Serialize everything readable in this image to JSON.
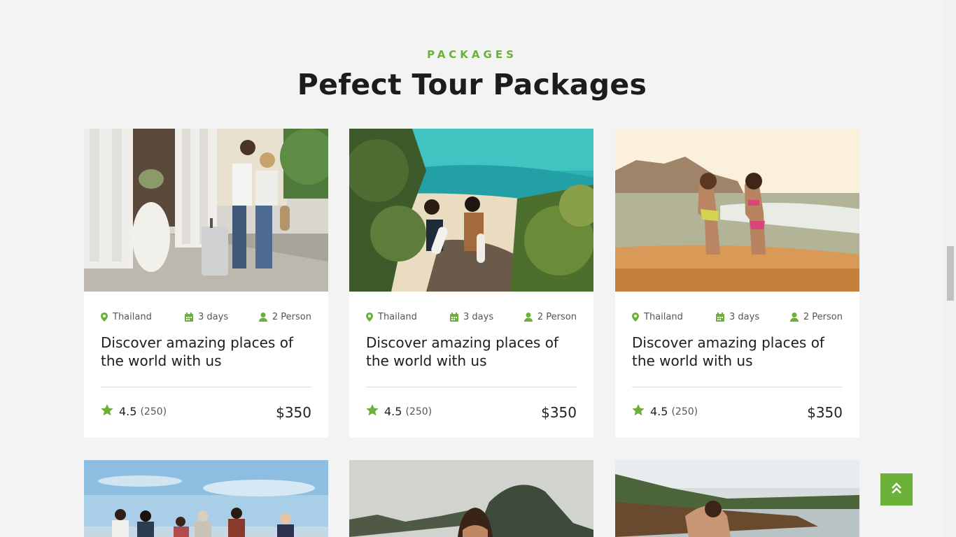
{
  "section": {
    "eyebrow": "PACKAGES",
    "title": "Pefect Tour Packages"
  },
  "cards": [
    {
      "location": "Thailand",
      "duration": "3 days",
      "persons": "2 Person",
      "title": "Discover amazing places of the world with us",
      "rating": "4.5",
      "reviews": "(250)",
      "price": "$350",
      "image": "couple-walking-with-suitcase"
    },
    {
      "location": "Thailand",
      "duration": "3 days",
      "persons": "2 Person",
      "title": "Discover amazing places of the world with us",
      "rating": "4.5",
      "reviews": "(250)",
      "price": "$350",
      "image": "surfers-at-tropical-beach"
    },
    {
      "location": "Thailand",
      "duration": "3 days",
      "persons": "2 Person",
      "title": "Discover amazing places of the world with us",
      "rating": "4.5",
      "reviews": "(250)",
      "price": "$350",
      "image": "two-women-in-sea-waves"
    }
  ],
  "lower_cards": [
    {
      "image": "group-of-friends-on-beach"
    },
    {
      "image": "woman-near-limestone-islands"
    },
    {
      "image": "woman-by-wooden-boat"
    }
  ],
  "icons": {
    "location": "map-pin-icon",
    "duration": "calendar-icon",
    "persons": "user-icon",
    "rating": "star-icon",
    "back_to_top": "double-chevron-up-icon"
  },
  "colors": {
    "accent": "#6bb038",
    "background": "#f3f3f3",
    "card": "#ffffff"
  }
}
